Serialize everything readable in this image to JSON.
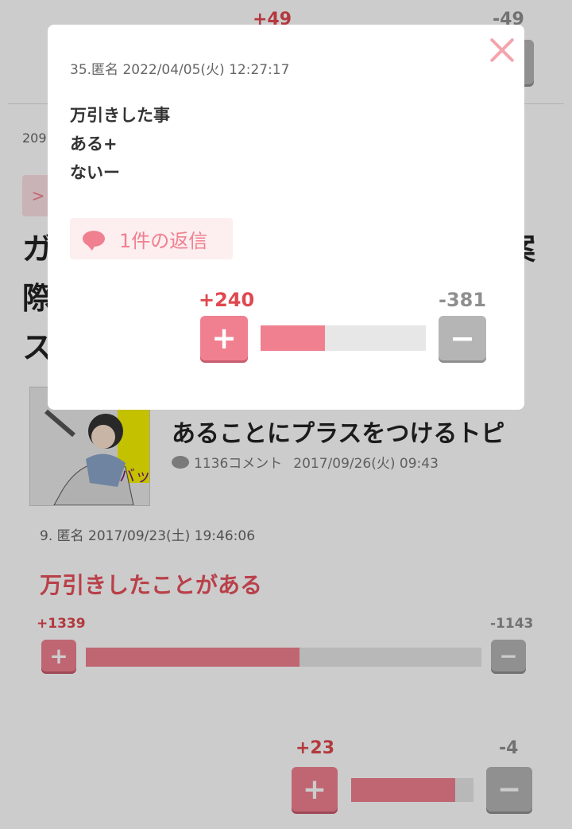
{
  "background_page": {
    "top_vote": {
      "plus": "+49",
      "minus": "-49"
    },
    "side_fragment_number": "209",
    "tag_fragment": ">",
    "headline_fragments": [
      "ガ",
      "際",
      "ス"
    ],
    "headline_right_fragments": [
      "案",
      "、"
    ],
    "related_topic": {
      "title_line1": "あることにプラスをつけるトピ",
      "comment_count": "1136コメント",
      "date": "2017/09/26(火) 09:43"
    },
    "comment9": {
      "header": "9. 匿名 2017/09/23(土) 19:46:06",
      "body": "万引きしたことがある",
      "plus": "+1339",
      "minus": "-1143",
      "plus_ratio": 0.54
    },
    "bottom_vote": {
      "plus": "+23",
      "minus": "-4",
      "plus_ratio": 0.85
    }
  },
  "modal": {
    "header": "35.匿名 2022/04/05(火) 12:27:17",
    "body_lines": [
      "万引きした事",
      "ある+",
      "ないー"
    ],
    "reply_label": "1件の返信",
    "plus": "+240",
    "minus": "-381",
    "plus_ratio": 0.39
  },
  "colors": {
    "accent_pink": "#f08090",
    "plus_text": "#e0484f",
    "minus_gray": "#b5b5b5",
    "comment_title": "#e8515c"
  },
  "icons": {
    "close": "close-icon",
    "plus": "plus-icon",
    "minus": "minus-icon",
    "reply": "speech-bubble-icon"
  }
}
